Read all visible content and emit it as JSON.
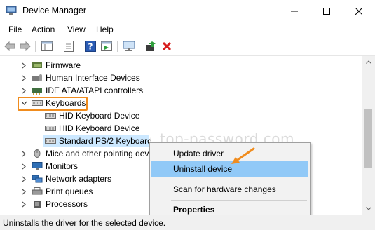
{
  "window": {
    "title": "Device Manager"
  },
  "menu": {
    "items": [
      "File",
      "Action",
      "View",
      "Help"
    ]
  },
  "tree": {
    "items": [
      {
        "label": "Firmware",
        "expanded": false,
        "icon": "firmware-icon"
      },
      {
        "label": "Human Interface Devices",
        "expanded": false,
        "icon": "hid-icon"
      },
      {
        "label": "IDE ATA/ATAPI controllers",
        "expanded": false,
        "icon": "ide-controller-icon"
      },
      {
        "label": "Keyboards",
        "expanded": true,
        "icon": "keyboard-icon",
        "children": [
          "HID Keyboard Device",
          "HID Keyboard Device",
          "Standard PS/2 Keyboard"
        ]
      },
      {
        "label": "Mice and other pointing dev",
        "expanded": false,
        "icon": "mouse-icon"
      },
      {
        "label": "Monitors",
        "expanded": false,
        "icon": "monitor-icon"
      },
      {
        "label": "Network adapters",
        "expanded": false,
        "icon": "network-adapter-icon"
      },
      {
        "label": "Print queues",
        "expanded": false,
        "icon": "printer-icon"
      },
      {
        "label": "Processors",
        "expanded": false,
        "icon": "processor-icon"
      }
    ]
  },
  "context_menu": {
    "items": [
      {
        "label": "Update driver",
        "highlighted": false,
        "bold": false
      },
      {
        "label": "Uninstall device",
        "highlighted": true,
        "bold": false
      },
      {
        "label": "Scan for hardware changes",
        "highlighted": false,
        "bold": false
      },
      {
        "label": "Properties",
        "highlighted": false,
        "bold": true
      }
    ]
  },
  "status": {
    "text": "Uninstalls the driver for the selected device."
  },
  "watermark": "top-password.com",
  "colors": {
    "highlight_box": "#f08c1e",
    "menu_highlight": "#91c9f7",
    "selected_row": "#cce8ff",
    "delete_red": "#d81e1e"
  }
}
